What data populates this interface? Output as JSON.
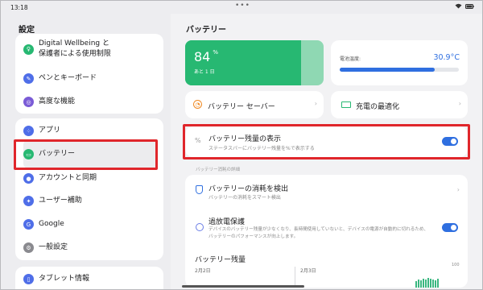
{
  "status": {
    "time": "13:18",
    "dots": "•••"
  },
  "left": {
    "title": "設定",
    "items": [
      {
        "label": "Digital Wellbeing と\n保護者による使用制限",
        "icon": "wellbeing-icon"
      },
      {
        "label": "ペンとキーボード",
        "icon": "pen-icon"
      },
      {
        "label": "高度な機能",
        "icon": "advanced-icon"
      },
      {
        "label": "アプリ",
        "icon": "apps-icon"
      },
      {
        "label": "バッテリー",
        "icon": "battery-icon"
      },
      {
        "label": "アカウントと同期",
        "icon": "account-icon"
      },
      {
        "label": "ユーザー補助",
        "icon": "accessibility-icon"
      },
      {
        "label": "Google",
        "icon": "google-icon"
      },
      {
        "label": "一般設定",
        "icon": "general-icon"
      },
      {
        "label": "タブレット情報",
        "icon": "tablet-info-icon"
      }
    ]
  },
  "right": {
    "title": "バッテリー",
    "battery": {
      "percent": "84",
      "unit": "%",
      "remaining": "あと 1 日",
      "level": 0.84
    },
    "temperature": {
      "label": "電池温度:",
      "value": "30.9°C",
      "level": 0.8
    },
    "saver": {
      "label": "バッテリー セーバー"
    },
    "optimize": {
      "label": "充電の最適化"
    },
    "percentage": {
      "title": "バッテリー残量の表示",
      "sub": "ステータスバーにバッテリー残量を%で表示する",
      "icon_text": "%",
      "on": true
    },
    "section_label": "バッテリー消耗の詳細",
    "detect": {
      "title": "バッテリーの消耗を検出",
      "sub": "バッテリーの消耗をスマート検出"
    },
    "overcharge": {
      "title": "過放電保護",
      "sub": "デバイスのバッテリー残量が少なくなり、長時間使用していないと、デバイスの電源が自動的に切れるため、バッテリーのパフォーマンスが向上します。",
      "on": true
    },
    "usage": {
      "title": "バッテリー残量",
      "date1": "2月2日",
      "date2": "2月3日",
      "ymax": "100"
    }
  },
  "colors": {
    "accent": "#2f6fe0",
    "battery_green": "#27b872",
    "highlight": "#e0262b"
  }
}
